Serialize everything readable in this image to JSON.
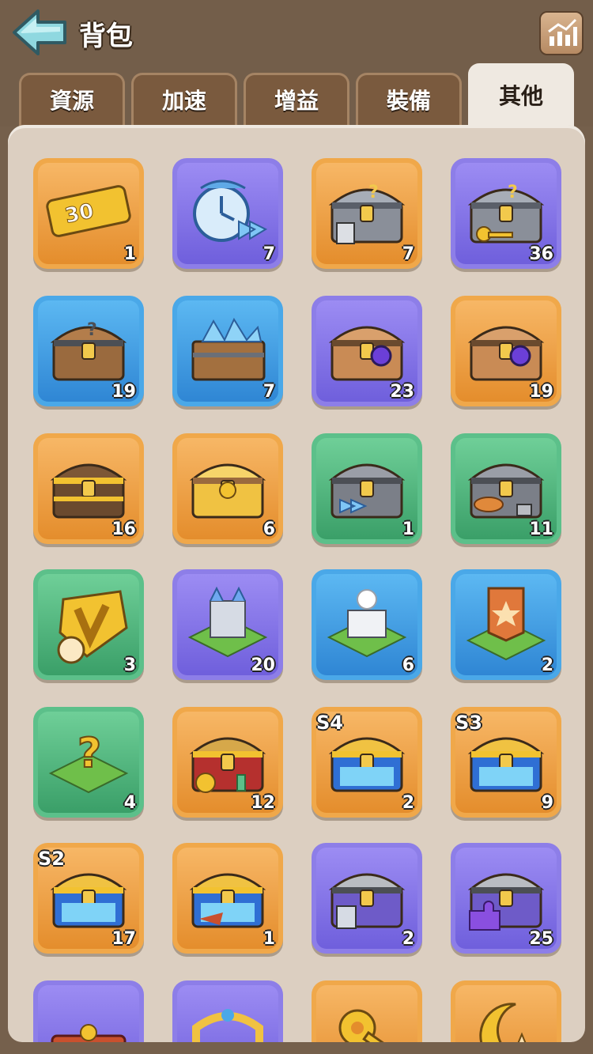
{
  "header": {
    "title": "背包",
    "back_icon": "back-arrow-icon",
    "stats_icon": "chart-icon"
  },
  "tabs": [
    {
      "label": "資源",
      "active": false
    },
    {
      "label": "加速",
      "active": false
    },
    {
      "label": "增益",
      "active": false
    },
    {
      "label": "裝備",
      "active": false
    },
    {
      "label": "其他",
      "active": true
    }
  ],
  "items": [
    {
      "icon": "ticket-30-icon",
      "ticket_text": "30",
      "color": "orange",
      "count": "1"
    },
    {
      "icon": "speedup-clock-icon",
      "color": "purple",
      "count": "7"
    },
    {
      "icon": "equipment-mystery-chest-icon",
      "color": "orange",
      "count": "7"
    },
    {
      "icon": "key-mystery-chest-icon",
      "color": "purple",
      "count": "36"
    },
    {
      "icon": "wooden-mystery-chest-icon",
      "color": "blue",
      "count": "19"
    },
    {
      "icon": "crystal-crate-icon",
      "color": "blue",
      "count": "7"
    },
    {
      "icon": "gem-chest-icon",
      "color": "purple",
      "count": "23"
    },
    {
      "icon": "gem-chest-icon",
      "color": "orange",
      "count": "19"
    },
    {
      "icon": "gold-iron-chest-icon",
      "color": "orange",
      "count": "16"
    },
    {
      "icon": "ornate-gold-chest-icon",
      "color": "orange",
      "count": "6"
    },
    {
      "icon": "speedup-open-chest-icon",
      "color": "green",
      "count": "1"
    },
    {
      "icon": "food-open-chest-icon",
      "color": "green",
      "count": "11"
    },
    {
      "icon": "vip-badge-clock-icon",
      "color": "green",
      "count": "3"
    },
    {
      "icon": "castle-tile-icon",
      "color": "purple",
      "count": "20"
    },
    {
      "icon": "fortress-tile-icon",
      "color": "blue",
      "count": "6"
    },
    {
      "icon": "banner-tile-icon",
      "color": "blue",
      "count": "2"
    },
    {
      "icon": "random-tile-icon",
      "color": "green",
      "count": "4"
    },
    {
      "icon": "treasure-pile-icon",
      "color": "orange",
      "count": "12"
    },
    {
      "icon": "season-chest-icon",
      "color": "orange",
      "badge": "S4",
      "count": "2"
    },
    {
      "icon": "season-chest-icon",
      "color": "orange",
      "badge": "S3",
      "count": "9"
    },
    {
      "icon": "season-chest-icon",
      "color": "orange",
      "badge": "S2",
      "count": "17"
    },
    {
      "icon": "blue-gold-chest-icon",
      "color": "orange",
      "count": "1"
    },
    {
      "icon": "purple-armor-chest-icon",
      "color": "purple",
      "count": "2"
    },
    {
      "icon": "purple-puzzle-chest-icon",
      "color": "purple",
      "count": "25"
    },
    {
      "icon": "decor-frame-icon",
      "color": "purple",
      "count": ""
    },
    {
      "icon": "ornate-gate-icon",
      "color": "purple",
      "count": ""
    },
    {
      "icon": "golden-key-icon",
      "color": "orange",
      "count": ""
    },
    {
      "icon": "moon-star-icon",
      "color": "orange",
      "count": ""
    }
  ]
}
